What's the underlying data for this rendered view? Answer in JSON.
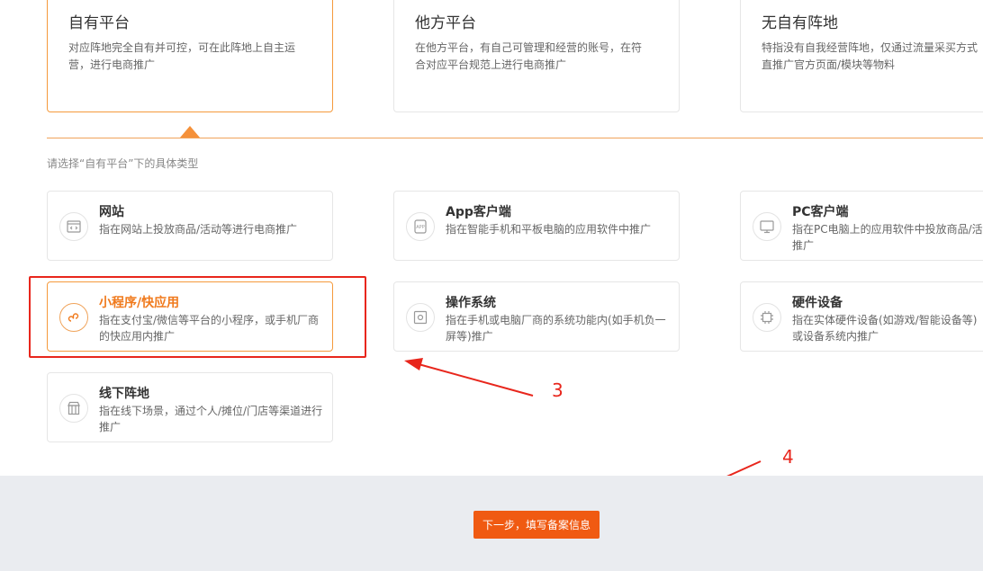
{
  "platforms": [
    {
      "title": "自有平台",
      "desc": "对应阵地完全自有并可控，可在此阵地上自主运营，进行电商推广",
      "selected": true
    },
    {
      "title": "他方平台",
      "desc": "在他方平台，有自己可管理和经营的账号，在符合对应平台规范上进行电商推广",
      "selected": false
    },
    {
      "title": "无自有阵地",
      "desc": "特指没有自我经营阵地，仅通过流量采买方式直推广官方页面/模块等物料",
      "selected": false
    }
  ],
  "hint": "请选择“自有平台”下的具体类型",
  "types": [
    {
      "title": "网站",
      "desc": "指在网站上投放商品/活动等进行电商推广",
      "icon": "website-icon"
    },
    {
      "title": "App客户端",
      "desc": "指在智能手机和平板电脑的应用软件中推广",
      "icon": "app-icon"
    },
    {
      "title": "PC客户端",
      "desc": "指在PC电脑上的应用软件中投放商品/活推广",
      "icon": "pc-icon"
    },
    {
      "title": "小程序/快应用",
      "desc": "指在支付宝/微信等平台的小程序，或手机厂商的快应用内推广",
      "icon": "mini-program-icon",
      "selected": true
    },
    {
      "title": "操作系统",
      "desc": "指在手机或电脑厂商的系统功能内(如手机负一屏等)推广",
      "icon": "os-icon"
    },
    {
      "title": "硬件设备",
      "desc": "指在实体硬件设备(如游戏/智能设备等)或设备系统内推广",
      "icon": "chip-icon"
    },
    {
      "title": "线下阵地",
      "desc": "指在线下场景，通过个人/摊位/门店等渠道进行推广",
      "icon": "store-icon"
    }
  ],
  "footer": {
    "next_label": "下一步，填写备案信息"
  },
  "annotations": {
    "label_3": "3",
    "label_4": "4"
  },
  "colors": {
    "accent": "#f07a1d",
    "button": "#f05a12",
    "annotation": "#e8261c"
  }
}
